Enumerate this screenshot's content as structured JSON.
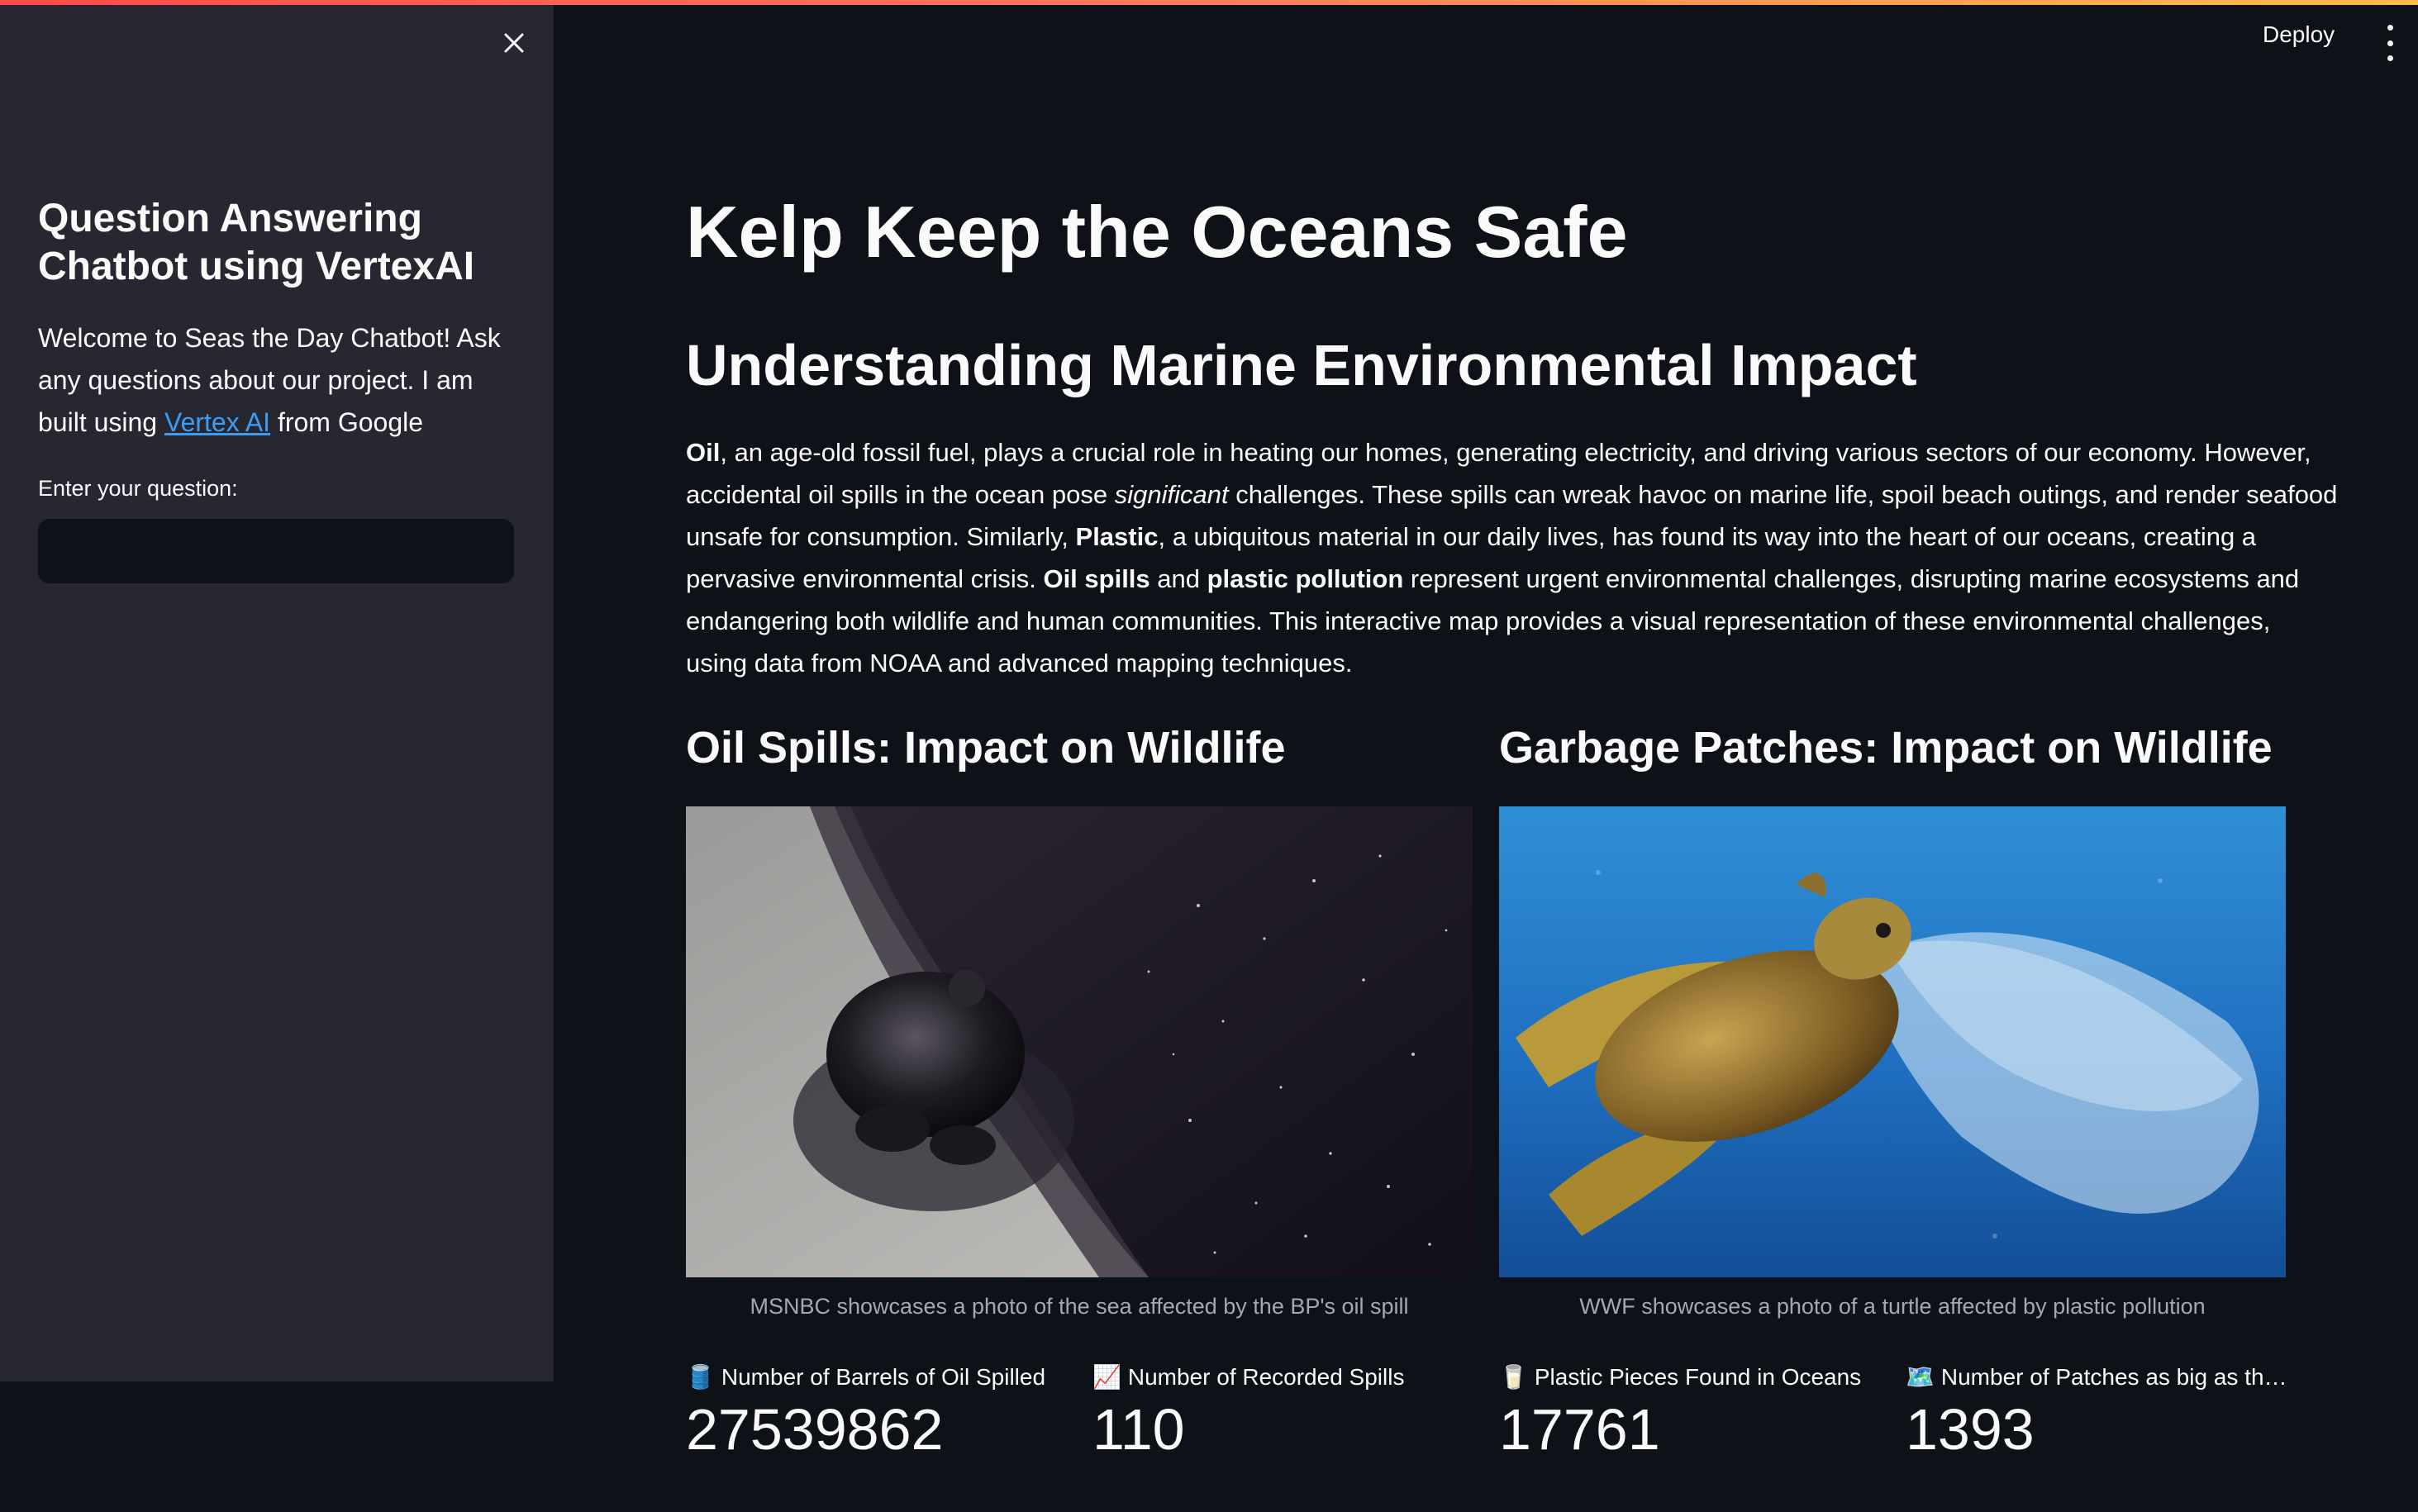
{
  "sidebar": {
    "title": "Question Answering Chatbot using VertexAI",
    "desc_before": "Welcome to Seas the Day Chatbot! Ask any questions about our project. I am built using ",
    "desc_link": "Vertex AI",
    "desc_after": " from Google",
    "input_label": "Enter your question:",
    "input_value": "",
    "close_icon": "close-icon"
  },
  "header": {
    "deploy_label": "Deploy",
    "menu_icon": "kebab-menu-icon"
  },
  "main": {
    "title": "Kelp Keep the Oceans Safe",
    "subtitle": "Understanding Marine Environmental Impact",
    "intro": {
      "p1_bold": "Oil",
      "p1": ", an age-old fossil fuel, plays a crucial role in heating our homes, generating electricity, and driving various sectors of our economy. However, accidental oil spills in the ocean pose ",
      "p1_italic": "significant",
      "p2": " challenges. These spills can wreak havoc on marine life, spoil beach outings, and render seafood unsafe for consumption. Similarly, ",
      "p2_bold": "Plastic",
      "p3": ", a ubiquitous material in our daily lives, has found its way into the heart of our oceans, creating a pervasive environmental crisis. ",
      "p3_bold1": "Oil spills",
      "p3_and": " and ",
      "p3_bold2": "plastic pollution",
      "p4": " represent urgent environmental challenges, disrupting marine ecosystems and endangering both wildlife and human communities. This interactive map provides a visual representation of these environmental challenges, using data from NOAA and advanced mapping techniques."
    },
    "columns": [
      {
        "title": "Oil Spills: Impact on Wildlife",
        "caption": "MSNBC showcases a photo of the sea affected by the BP's oil spill",
        "metrics": [
          {
            "icon": "oil-barrel-icon",
            "glyph": "🛢️",
            "label": "Number of Barrels of Oil Spilled",
            "value": "27539862"
          },
          {
            "icon": "chart-increasing-icon",
            "glyph": "📈",
            "label": "Number of Recorded Spills",
            "value": "110"
          }
        ]
      },
      {
        "title": "Garbage Patches: Impact on Wildlife",
        "caption": "WWF showcases a photo of a turtle affected by plastic pollution",
        "metrics": [
          {
            "icon": "cup-icon",
            "glyph": "🥛",
            "label": "Plastic Pieces Found in Oceans",
            "value": "17761"
          },
          {
            "icon": "map-icon",
            "glyph": "🗺️",
            "label": "Number of Patches as big as the P...",
            "value": "1393"
          }
        ]
      }
    ]
  },
  "colors": {
    "background": "#0e1117",
    "sidebar": "#262730",
    "link": "#3d9df3",
    "caption": "#a3a8b8"
  }
}
